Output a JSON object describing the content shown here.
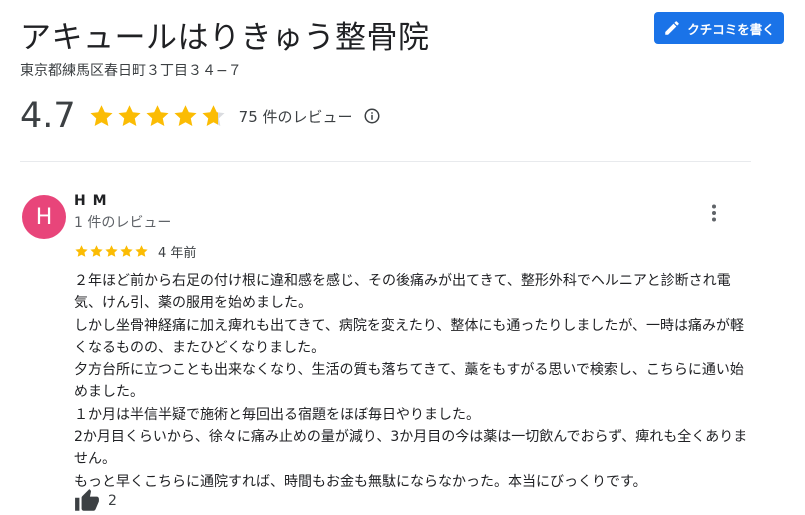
{
  "place": {
    "name": "アキュールはりきゅう整骨院",
    "address": "東京都練馬区春日町３丁目３４−７"
  },
  "write_review_button": {
    "label": "クチコミを書く",
    "icon": "pencil-icon"
  },
  "rating": {
    "score": "4.7",
    "stars_value": 4.7,
    "count_label": "75 件のレビュー",
    "info_icon": "info-icon"
  },
  "review": {
    "avatar_letter": "H",
    "avatar_color": "#e8457a",
    "reviewer_name": "H M",
    "reviewer_reviews": "1 件のレビュー",
    "stars": 5,
    "date": "4 年前",
    "paragraphs": [
      "２年ほど前から右足の付け根に違和感を感じ、その後痛みが出てきて、整形外科でヘルニアと診断され電気、けん引、薬の服用を始めました。",
      "しかし坐骨神経痛に加え痺れも出てきて、病院を変えたり、整体にも通ったりしましたが、一時は痛みが軽くなるものの、またひどくなりました。",
      "夕方台所に立つことも出来なくなり、生活の質も落ちてきて、藁をもすがる思いで検索し、こちらに通い始めました。",
      "１か月は半信半疑で施術と毎回出る宿題をほぼ毎日やりました。",
      "2か月目くらいから、徐々に痛み止めの量が減り、3か月目の今は薬は一切飲んでおらず、痺れも全くありません。",
      "もっと早くこちらに通院すれば、時間もお金も無駄にならなかった。本当にびっくりです。"
    ],
    "likes": "2",
    "menu_icon": "more-vert-icon",
    "like_icon": "thumbs-up-icon"
  },
  "colors": {
    "accent": "#1a73e8",
    "star": "#fbbc04",
    "star_empty": "#dadce0"
  }
}
